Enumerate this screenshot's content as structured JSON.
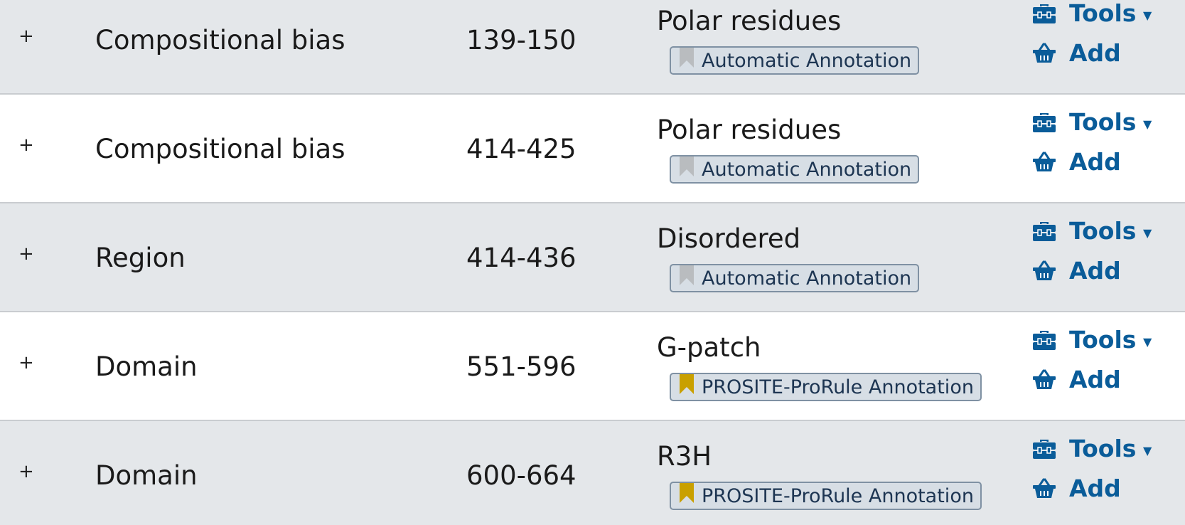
{
  "rows": [
    {
      "expand": "+",
      "feature_type": "Compositional bias",
      "position": "139-150",
      "description": "Polar residues",
      "evidence": "Automatic Annotation",
      "evidence_type": "automatic",
      "tools_label": "Tools",
      "add_label": "Add"
    },
    {
      "expand": "+",
      "feature_type": "Compositional bias",
      "position": "414-425",
      "description": "Polar residues",
      "evidence": "Automatic Annotation",
      "evidence_type": "automatic",
      "tools_label": "Tools",
      "add_label": "Add"
    },
    {
      "expand": "+",
      "feature_type": "Region",
      "position": "414-436",
      "description": "Disordered",
      "evidence": "Automatic Annotation",
      "evidence_type": "automatic",
      "tools_label": "Tools",
      "add_label": "Add"
    },
    {
      "expand": "+",
      "feature_type": "Domain",
      "position": "551-596",
      "description": "G-patch",
      "evidence": "PROSITE-ProRule Annotation",
      "evidence_type": "prorule",
      "tools_label": "Tools",
      "add_label": "Add"
    },
    {
      "expand": "+",
      "feature_type": "Domain",
      "position": "600-664",
      "description": "R3H",
      "evidence": "PROSITE-ProRule Annotation",
      "evidence_type": "prorule",
      "tools_label": "Tools",
      "add_label": "Add"
    }
  ],
  "colors": {
    "shaded_row": "#e4e7ea",
    "link": "#0a5c99",
    "bookmark_automatic": "#b9bcbf",
    "bookmark_prorule": "#c9a000"
  },
  "icons": {
    "tools": "toolbox-icon",
    "add": "basket-icon",
    "dropdown": "caret-down-icon",
    "evidence": "bookmark-icon"
  }
}
